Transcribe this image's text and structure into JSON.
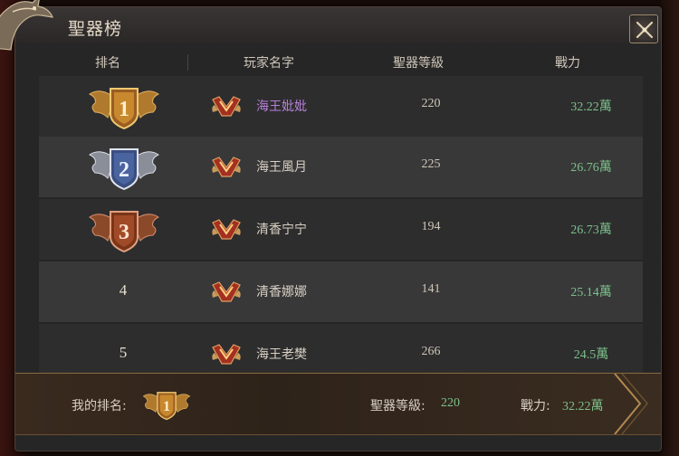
{
  "window": {
    "title": "聖器榜"
  },
  "columns": {
    "rank": "排名",
    "player": "玩家名字",
    "level": "聖器等級",
    "power": "戰力"
  },
  "rows": [
    {
      "rank": "1",
      "name": "海王妣妣",
      "level": "220",
      "power": "32.22萬",
      "name_color": "purple"
    },
    {
      "rank": "2",
      "name": "海王風月",
      "level": "225",
      "power": "26.76萬"
    },
    {
      "rank": "3",
      "name": "清香宁宁",
      "level": "194",
      "power": "26.73萬"
    },
    {
      "rank": "4",
      "name": "清香娜娜",
      "level": "141",
      "power": "25.14萬"
    },
    {
      "rank": "5",
      "name": "海王老樊",
      "level": "266",
      "power": "24.5萬"
    }
  ],
  "my_rank": {
    "label": "我的排名:",
    "rank": "1",
    "level_label": "聖器等級:",
    "level": "220",
    "power_label": "戰力:",
    "power": "32.22萬"
  },
  "colors": {
    "gold": "#c8913c",
    "silver": "#9aa4b4",
    "bronze": "#a85a32",
    "power_green": "#7cc08a",
    "name_purple": "#b880d8"
  },
  "icons": {
    "close": "close-icon",
    "vip": "vip-v-icon",
    "dragon": "dragon-emblem-icon"
  }
}
